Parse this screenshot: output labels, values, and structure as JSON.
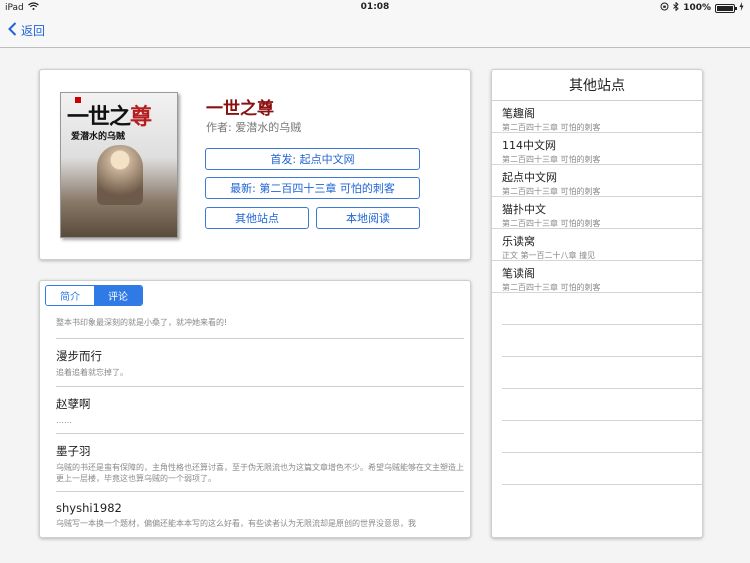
{
  "statusbar": {
    "device": "iPad",
    "time": "01:08",
    "battery": "100%"
  },
  "nav": {
    "back_label": "返回"
  },
  "book": {
    "title": "一世之尊",
    "author": "作者:  爱潜水的乌贼",
    "cover": {
      "title_part1": "一世之",
      "title_part2": "尊",
      "author": "爱潜水的乌贼"
    },
    "first_publish_button": "首发:  起点中文网",
    "latest_button": "最新:  第二百四十三章 可怕的刺客",
    "other_sites_button": "其他站点",
    "local_read_button": "本地阅读"
  },
  "tabs": {
    "intro": "简介",
    "comments": "评论"
  },
  "comments": [
    {
      "name": "",
      "body": "整本书印象最深刻的就是小桑了，就冲她来看的!"
    },
    {
      "name": "漫步而行",
      "body": "追着追着就忘掉了。"
    },
    {
      "name": "赵孽啊",
      "body": "……"
    },
    {
      "name": "墨子羽",
      "body": "乌贼的书还是蛮有保障的，主角性格也还算讨喜，至于伪无限流也为这篇文章增色不少。希望乌贼能够在文主塑造上更上一层楼，毕竟这也算乌贼的一个弱项了。"
    },
    {
      "name": "shyshi1982",
      "body": "乌贼写一本换一个题材，偏偏还能本本写的这么好看，有些读者认为无限流却是原创的世界没意思，我"
    }
  ],
  "sites": {
    "title": "其他站点",
    "items": [
      {
        "name": "笔趣阁",
        "chapter": "第二百四十三章 可怕的刺客"
      },
      {
        "name": "114中文网",
        "chapter": "第二百四十三章 可怕的刺客"
      },
      {
        "name": "起点中文网",
        "chapter": "第二百四十三章 可怕的刺客"
      },
      {
        "name": "猫扑中文",
        "chapter": "第二百四十三章 可怕的刺客"
      },
      {
        "name": "乐读窝",
        "chapter": "正文 第一百二十八章 撞见"
      },
      {
        "name": "笔读阁",
        "chapter": "第二百四十三章 可怕的刺客"
      }
    ]
  }
}
